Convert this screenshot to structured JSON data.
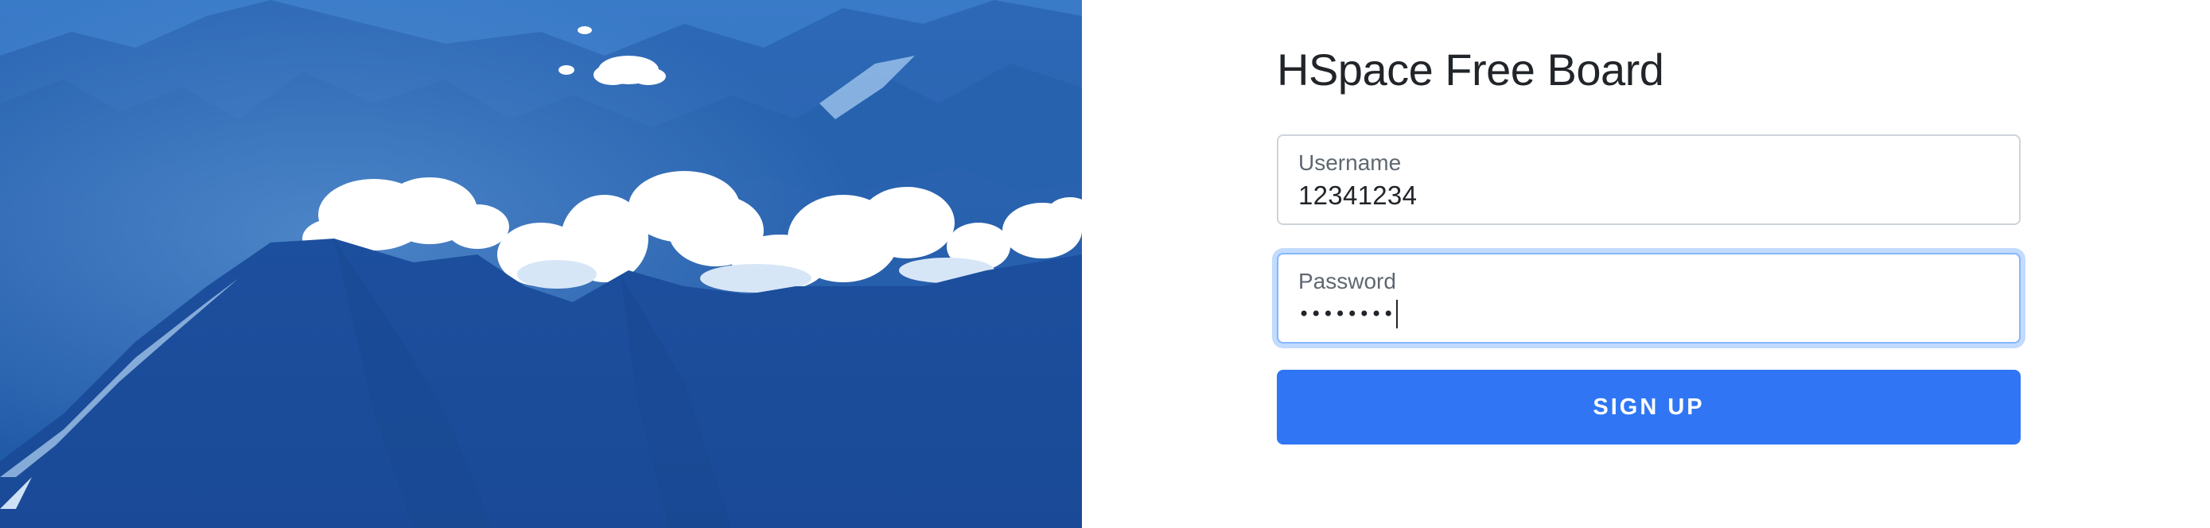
{
  "colors": {
    "accent": "#3076f4",
    "focus_border": "#86b7fe",
    "hero_blue": "#1d5aa8"
  },
  "hero": {
    "icon": "mountain-clouds-image"
  },
  "form": {
    "title": "HSpace Free Board",
    "username": {
      "label": "Username",
      "value": "12341234"
    },
    "password": {
      "label": "Password",
      "masked_value": "••••••••",
      "focused": true
    },
    "submit_label": "SIGN UP"
  }
}
